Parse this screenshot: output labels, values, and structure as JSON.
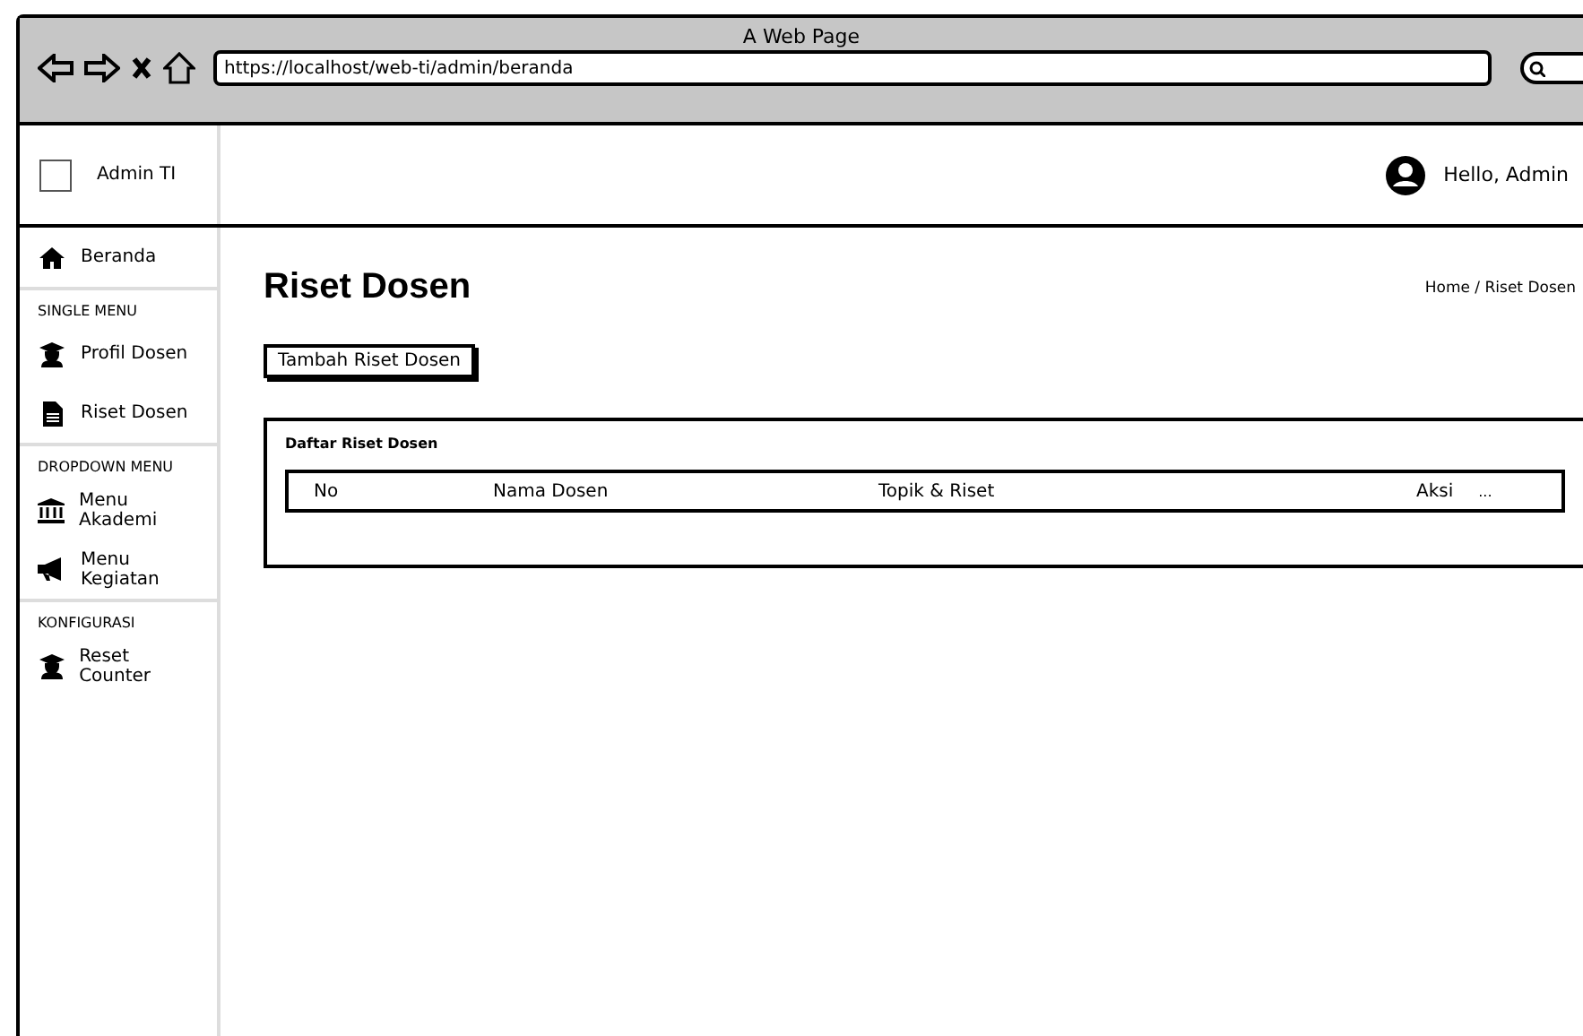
{
  "window": {
    "title": "A Web Page"
  },
  "browser": {
    "url": "https://localhost/web-ti/admin/beranda"
  },
  "header": {
    "brand": "Admin TI",
    "user": "Hello, Admin"
  },
  "sidebar": {
    "items": [
      {
        "kind": "item",
        "label": "Beranda"
      },
      {
        "kind": "section",
        "label": "SINGLE MENU"
      },
      {
        "kind": "item",
        "label": "Profil Dosen"
      },
      {
        "kind": "item",
        "label": "Riset Dosen"
      },
      {
        "kind": "section",
        "label": "DROPDOWN MENU"
      },
      {
        "kind": "item",
        "label": "Menu Akademi"
      },
      {
        "kind": "item",
        "label": "Menu Kegiatan"
      },
      {
        "kind": "section",
        "label": "KONFIGURASI"
      },
      {
        "kind": "item",
        "label": "Reset Counter"
      }
    ]
  },
  "page": {
    "title": "Riset Dosen",
    "breadcrumb": "Home / Riset Dosen",
    "add_button": "Tambah Riset Dosen"
  },
  "card": {
    "title": "Daftar Riset Dosen",
    "columns": [
      "No",
      "Nama Dosen",
      "Topik & Riset",
      "Aksi"
    ],
    "more": "..."
  }
}
